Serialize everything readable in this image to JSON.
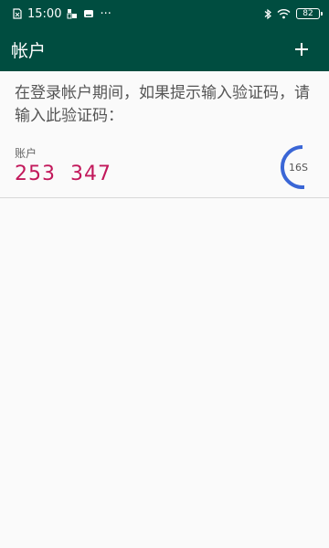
{
  "status_bar": {
    "time": "15:00",
    "more": "···",
    "battery": "82"
  },
  "app_bar": {
    "title": "帐户",
    "add_icon": "plus-icon"
  },
  "instructions": "在登录帐户期间，如果提示输入验证码，请输入此验证码：",
  "accounts": [
    {
      "label": "账户",
      "code": "253  347",
      "timer_label": "16S",
      "timer_remaining_fraction": 0.53
    }
  ],
  "colors": {
    "primary": "#004d40",
    "code": "#c2185b",
    "timer": "#3a66d6",
    "background": "#fafafa"
  }
}
